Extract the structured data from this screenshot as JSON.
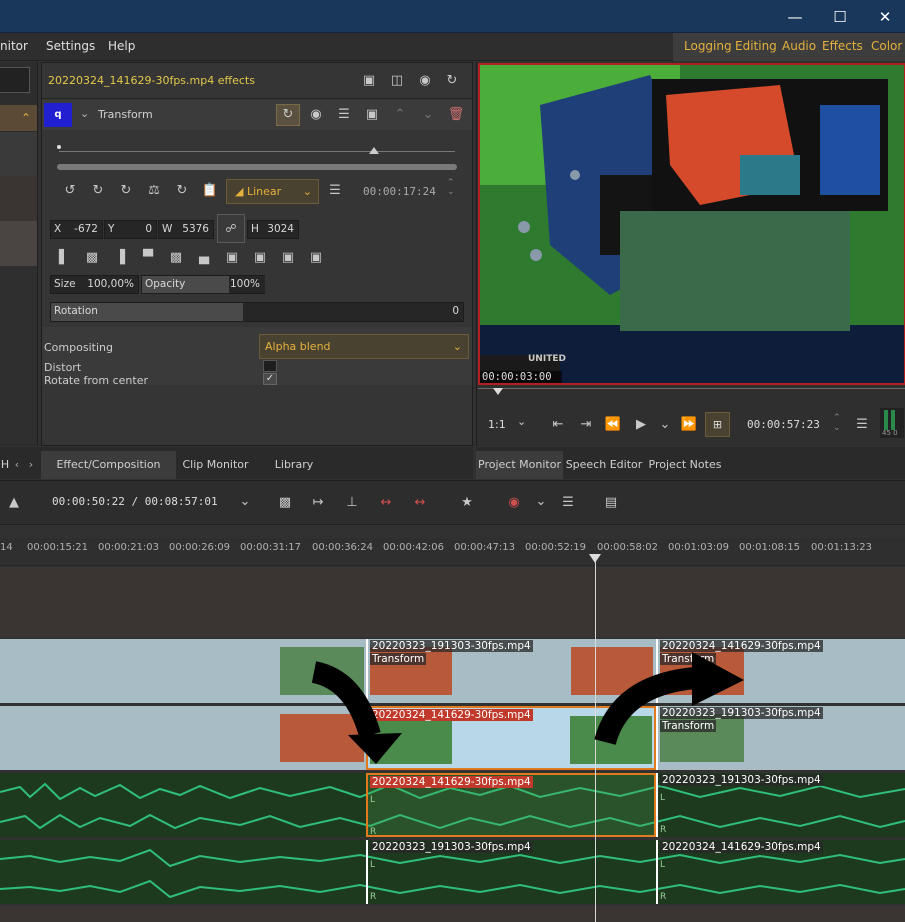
{
  "menu": {
    "items": [
      "nitor",
      "Settings",
      "Help"
    ]
  },
  "layouts": [
    "Logging",
    "Editing",
    "Audio",
    "Effects",
    "Color"
  ],
  "effects": {
    "title": "20220324_141629-30fps.mp4 effects",
    "effect_name": "Transform",
    "keyframe_badge": "q",
    "interp": "Linear",
    "timecode": "00:00:17:24",
    "x_label": "X",
    "x": "-672",
    "y_label": "Y",
    "y": "0",
    "w_label": "W",
    "w": "5376",
    "h_label": "H",
    "h": "3024",
    "size_label": "Size",
    "size": "100,00%",
    "opacity_label": "Opacity",
    "opacity": "100%",
    "rotation_label": "Rotation",
    "rotation": "0",
    "compositing_label": "Compositing",
    "compositing": "Alpha blend",
    "distort_label": "Distort",
    "rotate_center_label": "Rotate from center"
  },
  "monitor": {
    "overlay_tc": "00:00:03:00",
    "zoom": "1:1",
    "timecode": "00:00:57:23",
    "meter": "45 0"
  },
  "tabs_left": [
    "H",
    "Effect/Composition Stack",
    "Clip Monitor",
    "Library"
  ],
  "tabs_right": [
    "Project Monitor",
    "Speech Editor",
    "Project Notes"
  ],
  "timeline": {
    "position": "00:00:50:22 / 00:08:57:01",
    "ruler": [
      "14",
      "00:00:15:21",
      "00:00:21:03",
      "00:00:26:09",
      "00:00:31:17",
      "00:00:36:24",
      "00:00:42:06",
      "00:00:47:13",
      "00:00:52:19",
      "00:00:58:02",
      "00:01:03:09",
      "00:01:08:15",
      "00:01:13:23"
    ]
  },
  "clips": {
    "v2_a": "20220323_191303-30fps.mp4",
    "v2_a_effect": "Transform",
    "v2_b": "20220324_141629-30fps.mp4",
    "v2_b_effect": "Transform",
    "v1_a": "20220324_141629-30fps.mp4",
    "v1_b": "20220323_191303-30fps.mp4",
    "v1_b_effect": "Transform",
    "a1_a": "20220324_141629-30fps.mp4",
    "a1_b": "20220323_191303-30fps.mp4",
    "a2_a": "20220323_191303-30fps.mp4",
    "a2_b": "20220324_141629-30fps.mp4",
    "ch_l": "L",
    "ch_r": "R"
  },
  "colors": {
    "accent": "#e5b13d",
    "selection": "#e07a1f",
    "audio": "#2fbf7a",
    "titlebar": "#19375a"
  }
}
